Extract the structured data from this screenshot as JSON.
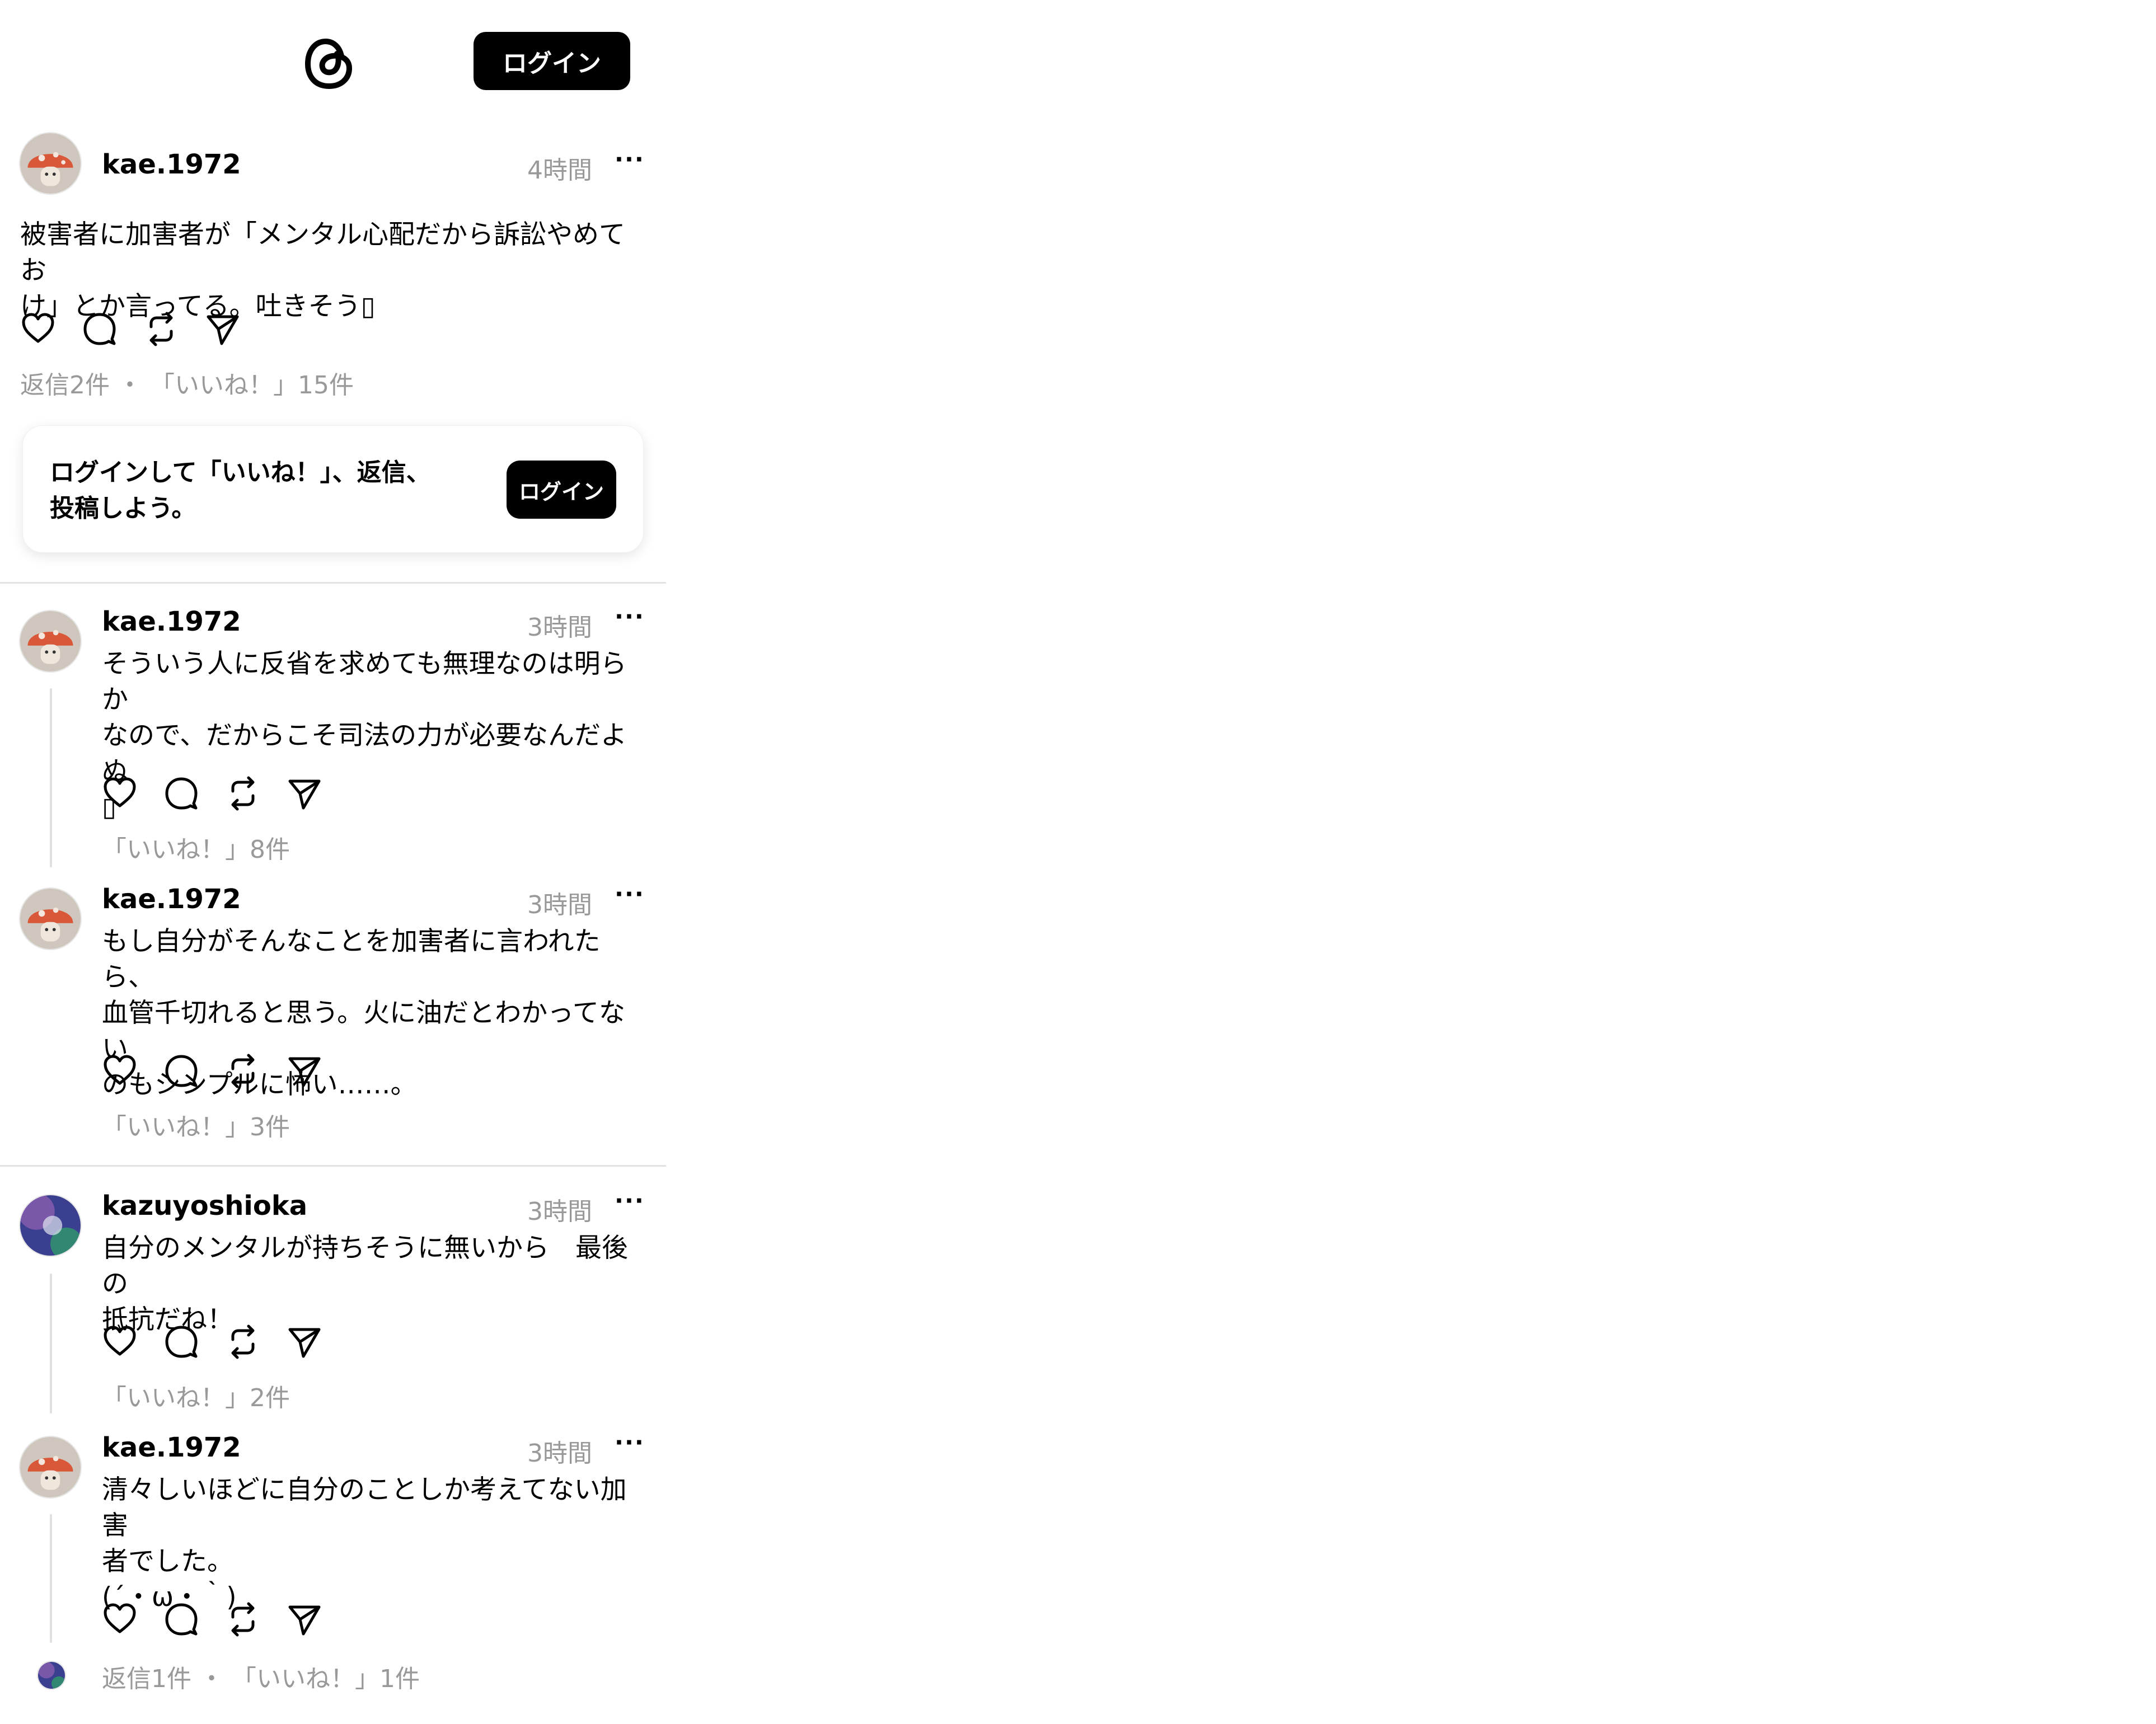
{
  "header": {
    "login_label": "ログイン",
    "logo_icon": "threads-logo-icon"
  },
  "main_post": {
    "username": "kae.1972",
    "time": "4時間",
    "more": "···",
    "text": "被害者に加害者が「メンタル心配だから訴訟やめてお\nけ」とか言ってる。吐きそう▯",
    "stats": "返信2件 ・ 「いいね！」15件"
  },
  "login_card": {
    "text": "ログインして「いいね！」、返信、\n投稿しよう。",
    "button_label": "ログイン"
  },
  "replies": [
    {
      "username": "kae.1972",
      "time": "3時間",
      "more": "···",
      "text": "そういう人に反省を求めても無理なのは明らか\nなので、だからこそ司法の力が必要なんだよぬ\n▯",
      "stats": "「いいね！」8件"
    },
    {
      "username": "kae.1972",
      "time": "3時間",
      "more": "···",
      "text": "もし自分がそんなことを加害者に言われたら、\n血管千切れると思う。火に油だとわかってない\nのもシンプルに怖い……。",
      "stats": "「いいね！」3件"
    },
    {
      "username": "kazuyoshioka",
      "time": "3時間",
      "more": "···",
      "text": "自分のメンタルが持ちそうに無いから　最後の\n抵抗だね！",
      "stats": "「いいね！」2件"
    },
    {
      "username": "kae.1972",
      "time": "3時間",
      "more": "···",
      "text": "清々しいほどに自分のことしか考えてない加害\n者でした。\n(´・ω・｀)",
      "stats": "返信1件 ・ 「いいね！」1件"
    }
  ],
  "icons": [
    "heart-icon",
    "comment-icon",
    "repost-icon",
    "share-icon"
  ]
}
